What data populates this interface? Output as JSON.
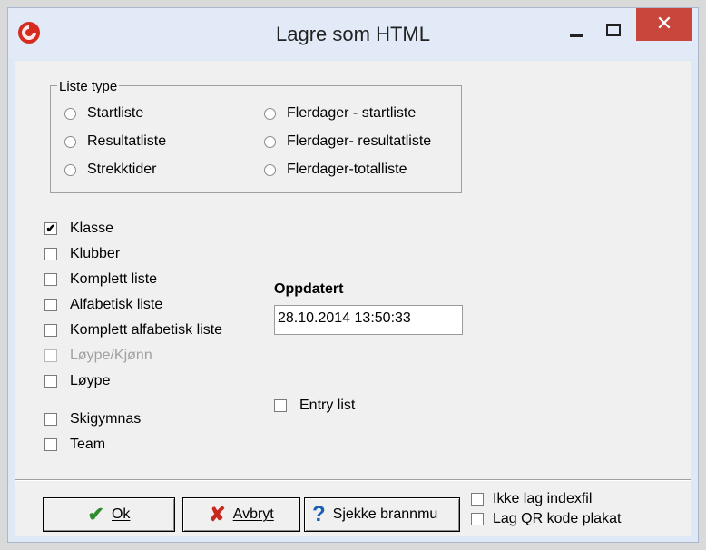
{
  "window": {
    "title": "Lagre som HTML",
    "close_glyph": "✕"
  },
  "list_type": {
    "legend": "Liste type",
    "options": [
      {
        "label": "Startliste"
      },
      {
        "label": "Resultatliste"
      },
      {
        "label": "Strekktider"
      },
      {
        "label": "Flerdager - startliste"
      },
      {
        "label": "Flerdager- resultatliste"
      },
      {
        "label": "Flerdager-totalliste"
      }
    ]
  },
  "checkboxes": [
    {
      "label": "Klasse",
      "checked": true
    },
    {
      "label": "Klubber",
      "checked": false
    },
    {
      "label": "Komplett liste",
      "checked": false
    },
    {
      "label": "Alfabetisk liste",
      "checked": false
    },
    {
      "label": "Komplett alfabetisk liste",
      "checked": false
    },
    {
      "label": "Løype/Kjønn",
      "checked": false,
      "disabled": true
    },
    {
      "label": "Løype",
      "checked": false
    },
    {
      "label": "Skigymnas",
      "checked": false
    },
    {
      "label": "Team",
      "checked": false
    }
  ],
  "updated": {
    "label": "Oppdatert",
    "value": "28.10.2014 13:50:33"
  },
  "entry_list": {
    "label": "Entry list",
    "checked": false
  },
  "footer": {
    "ok_label": "Ok",
    "cancel_label": "Avbryt",
    "check_label": "Sjekke brannmu",
    "no_index_label": "Ikke lag indexfil",
    "qr_label": "Lag QR kode plakat"
  },
  "colors": {
    "close_button": "#c9463d",
    "ok_check": "#2e8b2e",
    "cancel_x": "#c8281e",
    "question": "#1a5fb4"
  }
}
